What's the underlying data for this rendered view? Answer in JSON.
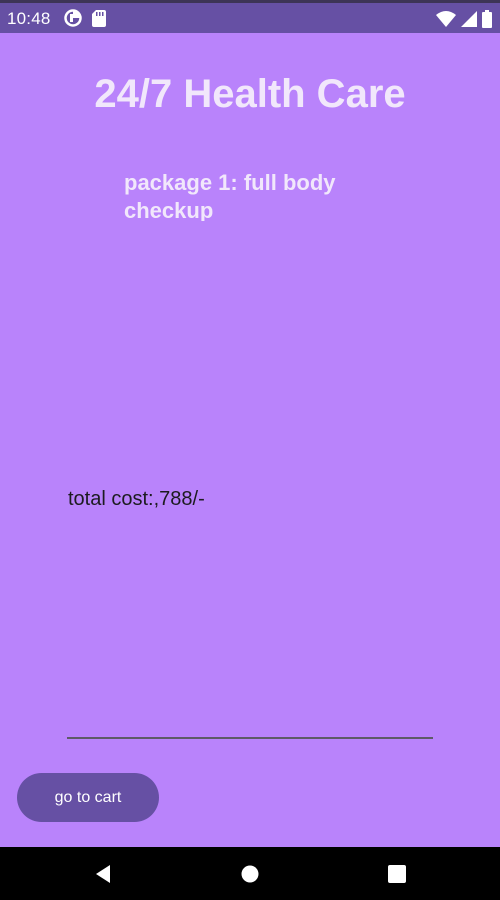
{
  "status_bar": {
    "time": "10:48",
    "left_icons": [
      "data-saver-icon",
      "sd-card-icon"
    ],
    "right_icons": [
      "wifi-icon",
      "cell-signal-icon",
      "battery-icon"
    ],
    "background": "#6650a4"
  },
  "app": {
    "title": "24/7 Health Care",
    "package_title": "package 1: full body checkup",
    "total_cost": "total cost:,788/-",
    "cart_button_label": "go to cart",
    "background": "#b983fb",
    "accent": "#6650a4"
  },
  "nav_bar": {
    "buttons": [
      "back-icon",
      "home-icon",
      "recents-icon"
    ]
  }
}
